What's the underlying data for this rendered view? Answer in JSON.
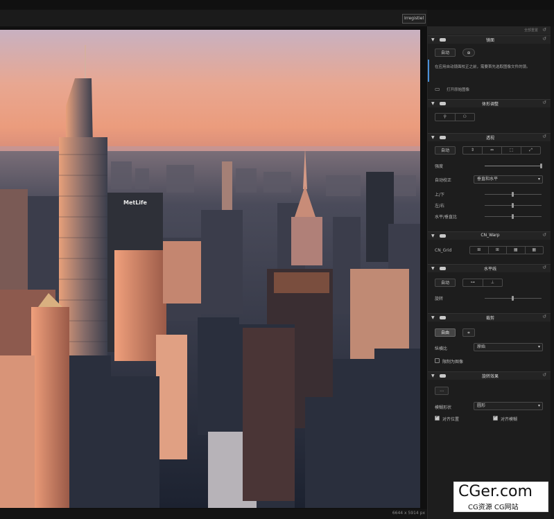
{
  "toolbar": {
    "tag": "Irregistiel"
  },
  "canvas": {
    "dimensions": "6644 x 5914 px"
  },
  "photo": {
    "sign": "MetLife"
  },
  "panel": {
    "header": "全部重置",
    "lens": {
      "title": "镜面",
      "auto": "自动",
      "note": "在应用自动镜面校正之前，需要首先选取图像文件的镜。",
      "open": "打开原始图像"
    },
    "body": {
      "title": "体形调整"
    },
    "perspective": {
      "title": "透视",
      "auto": "自动",
      "strength": "强度",
      "auto_correct": "自动校正",
      "auto_correct_value": "垂直和水平",
      "vertical": "上/下",
      "horizontal": "左/右",
      "aspect": "水平/垂直比"
    },
    "warp": {
      "title": "CN_Warp",
      "grid": "CN_Grid"
    },
    "horizon": {
      "title": "水平线",
      "auto": "自动",
      "rotation": "旋转"
    },
    "crop": {
      "title": "裁剪",
      "auto": "自由",
      "ratio": "纵横比",
      "ratio_value": "原始",
      "constrain": "限制为图像"
    },
    "rotation_effect": {
      "title": "旋转效果",
      "lens_shape": "模糊形状",
      "lens_shape_value": "圆形",
      "align": "对齐位置",
      "align2": "对齐模糊"
    }
  },
  "watermark": {
    "big": "CGer.com",
    "small": "CG资源 CG网站"
  }
}
